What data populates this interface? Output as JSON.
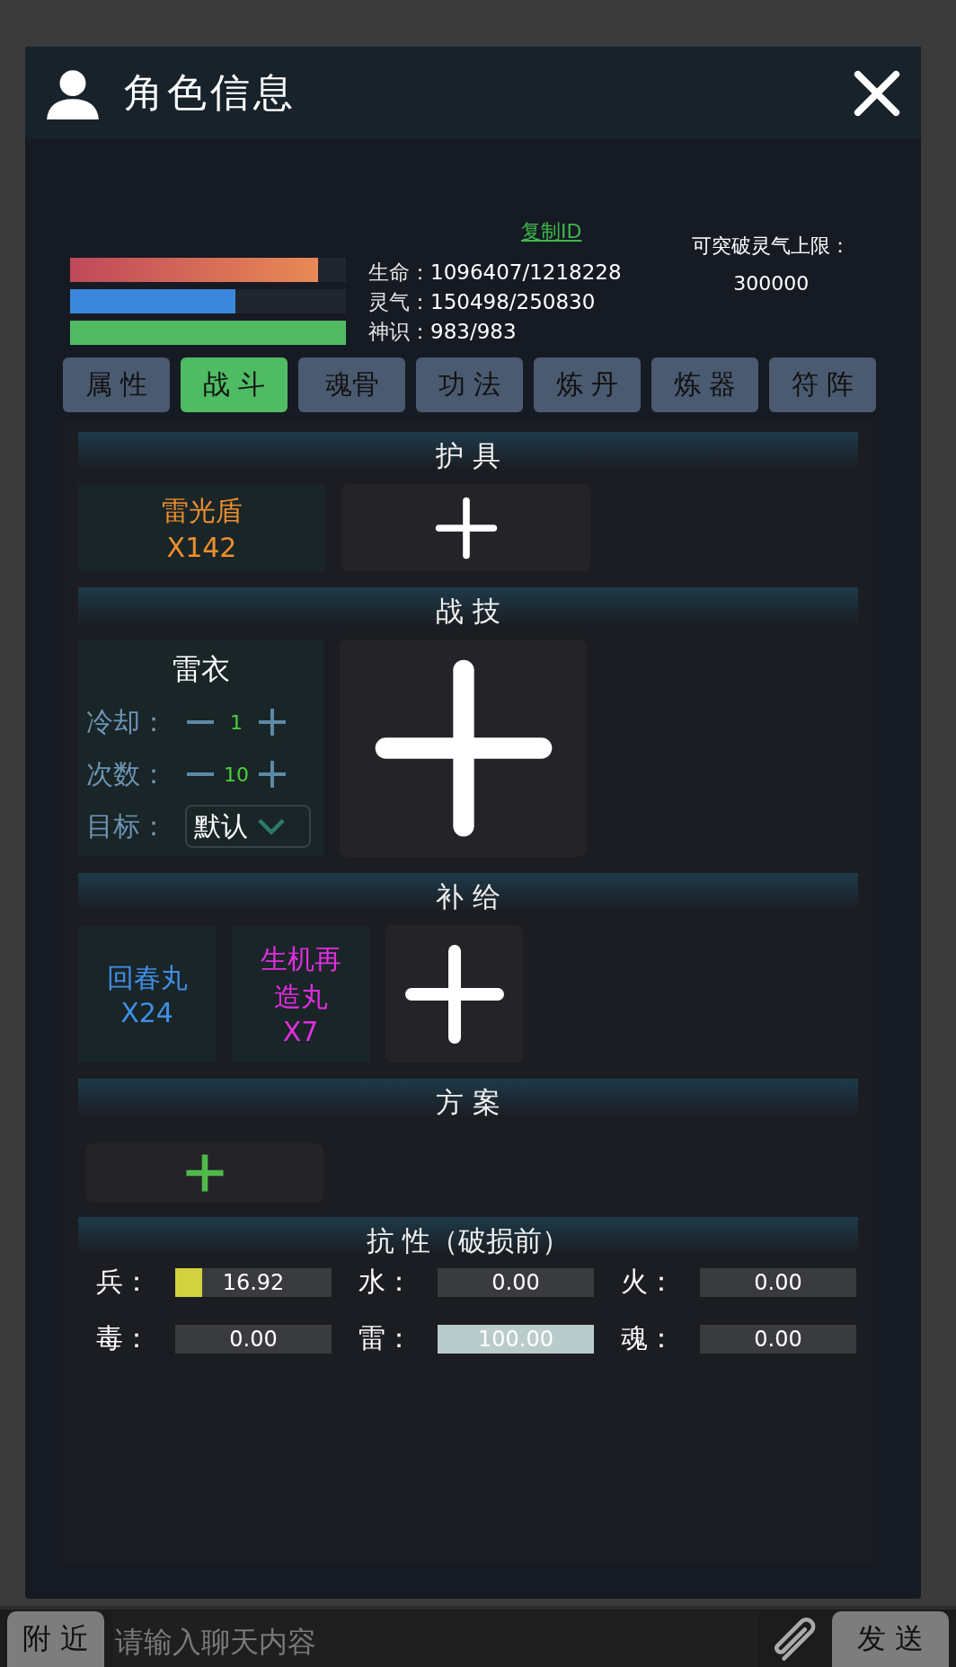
{
  "header": {
    "title": "角色信息"
  },
  "profile": {
    "copy_id": "复制ID",
    "bars": [
      {
        "kind": "life",
        "level": 0.9
      },
      {
        "kind": "spirit",
        "level": 0.6
      },
      {
        "kind": "sense",
        "level": 1
      }
    ],
    "stats": [
      {
        "label": "生命：",
        "value": "1096407/1218228"
      },
      {
        "label": "灵气：",
        "value": "150498/250830"
      },
      {
        "label": "神识：",
        "value": "983/983"
      }
    ],
    "breakthrough": {
      "label": "可突破灵气上限：",
      "value": "300000"
    }
  },
  "tabs": [
    {
      "label": "属 性",
      "selected": false
    },
    {
      "label": "战 斗",
      "selected": true
    },
    {
      "label": "魂骨",
      "selected": false
    },
    {
      "label": "功 法",
      "selected": false
    },
    {
      "label": "炼 丹",
      "selected": false
    },
    {
      "label": "炼 器",
      "selected": false
    },
    {
      "label": "符 阵",
      "selected": false
    }
  ],
  "armor": {
    "title": "护 具",
    "items": [
      {
        "name": "雷光盾",
        "count": "X142",
        "color": "#ee902e"
      }
    ]
  },
  "skills": {
    "title": "战 技",
    "items": [
      {
        "name": "雷衣",
        "settings": [
          {
            "label": "冷却：",
            "value": "1"
          },
          {
            "label": "次数：",
            "value": "10"
          }
        ],
        "target": {
          "label": "目标：",
          "value": "默认"
        }
      }
    ]
  },
  "supplies": {
    "title": "补 给",
    "items": [
      {
        "name": "回春丸",
        "count": "X24",
        "color": "#3f8fe6"
      },
      {
        "name": "生机再造丸",
        "count": "X7",
        "color": "#e12ee0"
      }
    ]
  },
  "plans": {
    "title": "方 案"
  },
  "resistance": {
    "title": "抗 性（破损前）",
    "items": [
      {
        "label": "兵：",
        "value": "16.92",
        "level": 0.17,
        "color": "#d2d23e"
      },
      {
        "label": "水：",
        "value": "0.00"
      },
      {
        "label": "火：",
        "value": "0.00"
      },
      {
        "label": "毒：",
        "value": "0.00"
      },
      {
        "label": "雷：",
        "value": "100.00",
        "level": 1,
        "color": "#b9cccb"
      },
      {
        "label": "魂：",
        "value": "0.00"
      }
    ]
  },
  "chat": {
    "channel": "附 近",
    "placeholder": "请输入聊天内容",
    "send": "发 送"
  }
}
